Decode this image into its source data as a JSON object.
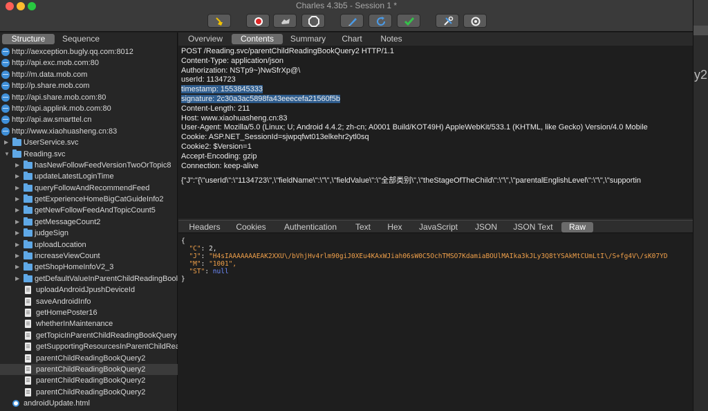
{
  "window": {
    "title": "Charles 4.3b5 - Session 1 *",
    "toolbar": [
      "broom-icon",
      "record-icon",
      "throttle-icon",
      "breakpoint-icon",
      "compose-icon",
      "repeat-icon",
      "validate-icon",
      "tools-icon",
      "settings-icon"
    ]
  },
  "left": {
    "tabs": [
      "Structure",
      "Sequence"
    ],
    "active_tab": "Structure",
    "tree": [
      {
        "label": "http://aexception.bugly.qq.com:8012",
        "kind": "host",
        "level": 0
      },
      {
        "label": "http://api.exc.mob.com:80",
        "kind": "host",
        "level": 0
      },
      {
        "label": "http://m.data.mob.com",
        "kind": "host",
        "level": 0
      },
      {
        "label": "http://p.share.mob.com",
        "kind": "host",
        "level": 0
      },
      {
        "label": "http://api.share.mob.com:80",
        "kind": "host",
        "level": 0
      },
      {
        "label": "http://api.applink.mob.com:80",
        "kind": "host",
        "level": 0
      },
      {
        "label": "http://api.aw.smarttel.cn",
        "kind": "host",
        "level": 0
      },
      {
        "label": "http://www.xiaohuasheng.cn:83",
        "kind": "host-open",
        "level": 0
      },
      {
        "label": "UserService.svc",
        "kind": "folder",
        "level": 1
      },
      {
        "label": "Reading.svc",
        "kind": "folder-open",
        "level": 1
      },
      {
        "label": "hasNewFollowFeedVersionTwoOrTopic8",
        "kind": "folder",
        "level": 2
      },
      {
        "label": "updateLatestLoginTime",
        "kind": "folder",
        "level": 2
      },
      {
        "label": "queryFollowAndRecommendFeed",
        "kind": "folder",
        "level": 2
      },
      {
        "label": "getExperienceHomeBigCatGuideInfo2",
        "kind": "folder",
        "level": 2
      },
      {
        "label": "getNewFollowFeedAndTopicCount5",
        "kind": "folder",
        "level": 2
      },
      {
        "label": "getMessageCount2",
        "kind": "folder",
        "level": 2
      },
      {
        "label": "judgeSign",
        "kind": "folder",
        "level": 2
      },
      {
        "label": "uploadLocation",
        "kind": "folder",
        "level": 2
      },
      {
        "label": "increaseViewCount",
        "kind": "folder",
        "level": 2
      },
      {
        "label": "getShopHomeInfoV2_3",
        "kind": "folder",
        "level": 2
      },
      {
        "label": "getDefaultValueInParentChildReadingBool",
        "kind": "folder",
        "level": 2
      },
      {
        "label": "uploadAndroidJpushDeviceId",
        "kind": "doc",
        "level": 2
      },
      {
        "label": "saveAndroidInfo",
        "kind": "doc",
        "level": 2
      },
      {
        "label": "getHomePoster16",
        "kind": "doc",
        "level": 2
      },
      {
        "label": "whetherInMaintenance",
        "kind": "doc",
        "level": 2
      },
      {
        "label": "getTopicInParentChildReadingBookQuery",
        "kind": "doc",
        "level": 2
      },
      {
        "label": "getSupportingResourcesInParentChildRea",
        "kind": "doc",
        "level": 2
      },
      {
        "label": "parentChildReadingBookQuery2",
        "kind": "doc",
        "level": 2
      },
      {
        "label": "parentChildReadingBookQuery2",
        "kind": "doc",
        "level": 2,
        "selected": true
      },
      {
        "label": "parentChildReadingBookQuery2",
        "kind": "doc",
        "level": 2
      },
      {
        "label": "parentChildReadingBookQuery2",
        "kind": "doc",
        "level": 2
      },
      {
        "label": "androidUpdate.html",
        "kind": "page",
        "level": 1
      }
    ]
  },
  "main": {
    "tabs": [
      "Overview",
      "Contents",
      "Summary",
      "Chart",
      "Notes"
    ],
    "active_tab": "Contents",
    "request_lines": [
      "POST /Reading.svc/parentChildReadingBookQuery2 HTTP/1.1",
      "Content-Type: application/json",
      "Authorization: NSTp9~)NwSfrXp@\\",
      "userId: 1134723",
      "timestamp: 1553845333",
      "signature: 2c30a3ac5898fa43eeecefa21560f5b",
      "Content-Length: 211",
      "Host: www.xiaohuasheng.cn:83",
      "User-Agent: Mozilla/5.0 (Linux; U; Android 4.4.2; zh-cn; A0001 Build/KOT49H) AppleWebKit/533.1 (KHTML, like Gecko) Version/4.0 Mobile",
      "Cookie: ASP.NET_SessionId=sjwpqfwt013elkehr2ytl0sq",
      "Cookie2: $Version=1",
      "Accept-Encoding: gzip",
      "Connection: keep-alive"
    ],
    "highlighted_lines": [
      4,
      5
    ],
    "request_body": "{\"J\":\"{\\\"userId\\\":\\\"1134723\\\",\\\"fieldName\\\":\\\"\\\",\\\"fieldValue\\\":\\\"全部类别\\\",\\\"theStageOfTheChild\\\":\\\"\\\",\\\"parentalEnglishLevel\\\":\\\"\\\",\\\"supportin",
    "response_tabs": [
      "Headers",
      "Cookies",
      "Authentication",
      "Text",
      "Hex",
      "JavaScript",
      "JSON",
      "JSON Text",
      "Raw"
    ],
    "active_response_tab": "Raw",
    "response_raw": {
      "open": "{",
      "C_key": "\"C\"",
      "C_val": "2,",
      "J_key": "\"J\"",
      "J_val": "\"H4sIAAAAAAAEAK2XXU\\/bVhjHv4rlm90giJ0XEu4KAxWJiah06sW0C5OchTMSO7KdamiaBOUlMAIka3kJLy3Q8tYSAkMtCUmLtI\\/S+fg4V\\/sK07YD",
      "M_key": "\"M\"",
      "M_val": "\"1001\",",
      "ST_key": "\"ST\"",
      "ST_val": "null",
      "close": "}"
    }
  },
  "colors": {
    "selection": "#2f5d8e",
    "json_string": "#f0a04a",
    "json_null": "#6f8cff",
    "folder": "#5fa8e6",
    "host_globe": "#3f8fd8"
  }
}
